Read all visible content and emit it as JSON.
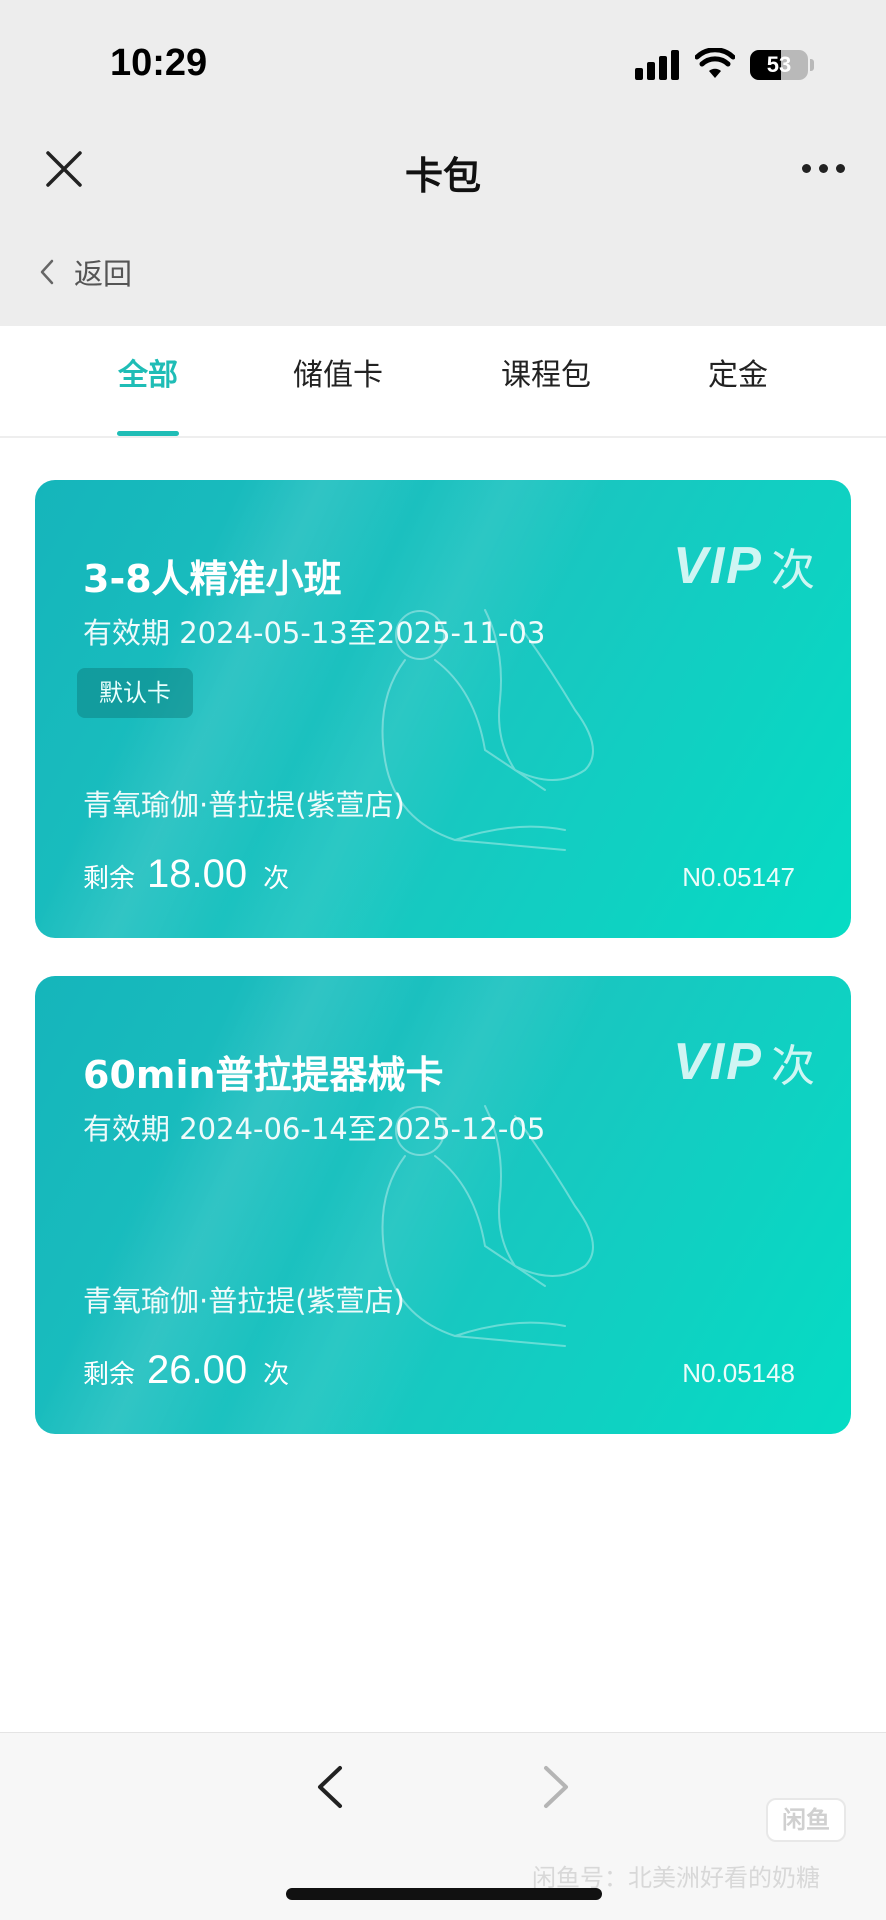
{
  "status_bar": {
    "time": "10:29",
    "battery": "53",
    "battery_level": 0.53
  },
  "header": {
    "title": "卡包",
    "back_label": "返回"
  },
  "tabs": [
    {
      "label": "全部",
      "active": true
    },
    {
      "label": "储值卡",
      "active": false
    },
    {
      "label": "课程包",
      "active": false
    },
    {
      "label": "定金",
      "active": false
    }
  ],
  "cards": [
    {
      "title": "3-8人精准小班",
      "validity": "有效期 2024-05-13至2025-11-03",
      "badge": "默认卡",
      "store": "青氧瑜伽·普拉提(紫萱店)",
      "remain_label": "剩余",
      "remain_value": "18.00",
      "remain_unit": "次",
      "number": "N0.05147",
      "vip": "VIP",
      "vip_type": "次"
    },
    {
      "title": "60min普拉提器械卡",
      "validity": "有效期 2024-06-14至2025-12-05",
      "badge": "",
      "store": "青氧瑜伽·普拉提(紫萱店)",
      "remain_label": "剩余",
      "remain_value": "26.00",
      "remain_unit": "次",
      "number": "N0.05148",
      "vip": "VIP",
      "vip_type": "次"
    }
  ],
  "watermark": {
    "logo_text": "闲鱼",
    "text": "闲鱼号：北美洲好看的奶糖"
  },
  "colors": {
    "accent": "#1fbdb6",
    "card_start": "#15b5bb",
    "card_end": "#05dcc4"
  },
  "icons": [
    "close-icon",
    "more-icon",
    "chevron-left-icon",
    "chevron-right-icon",
    "signal-icon",
    "wifi-icon",
    "battery-icon"
  ]
}
